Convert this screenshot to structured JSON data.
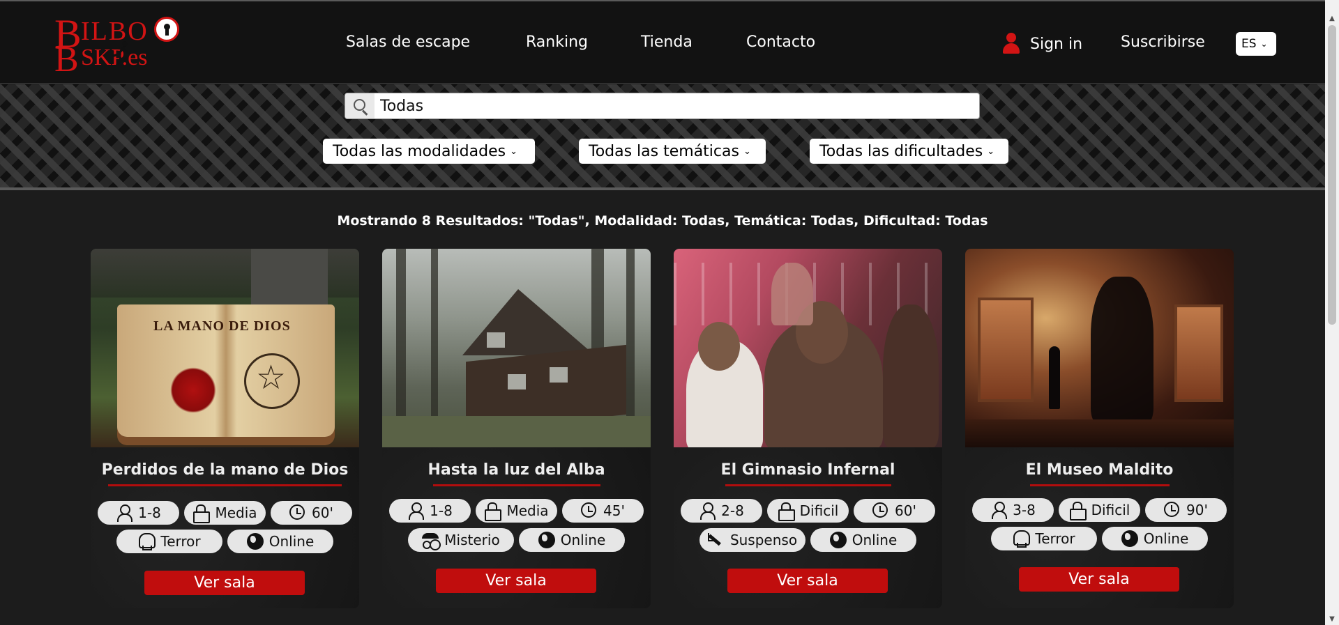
{
  "brand": {
    "logo_text_1": "B",
    "logo_text_2": "ILBO",
    "logo_text_3": "B",
    "logo_text_4": "SKP.es",
    "accent": "#d21414"
  },
  "nav": {
    "salas": "Salas de escape",
    "ranking": "Ranking",
    "tienda": "Tienda",
    "contacto": "Contacto"
  },
  "account": {
    "sign_in": "Sign in",
    "subscribe": "Suscribirse",
    "language": "ES"
  },
  "search": {
    "value": "Todas",
    "placeholder": ""
  },
  "filters": {
    "modalidad": "Todas las modalidades",
    "tematica": "Todas las temáticas",
    "dificultad": "Todas las dificultades"
  },
  "results_text": "Mostrando 8 Resultados: \"Todas\", Modalidad: Todas, Temática: Todas, Dificultad: Todas",
  "cards": [
    {
      "title": "Perdidos de la mano de Dios",
      "image_text": "LA MANO  DE DIOS",
      "players": "1-8",
      "difficulty": "Media",
      "duration": "60'",
      "theme": "Terror",
      "mode": "Online",
      "button": "Ver sala"
    },
    {
      "title": "Hasta la luz del Alba",
      "players": "1-8",
      "difficulty": "Media",
      "duration": "45'",
      "theme": "Misterio",
      "mode": "Online",
      "button": "Ver sala"
    },
    {
      "title": "El Gimnasio Infernal",
      "players": "2-8",
      "difficulty": "Dificil",
      "duration": "60'",
      "theme": "Suspenso",
      "mode": "Online",
      "button": "Ver sala"
    },
    {
      "title": "El Museo Maldito",
      "players": "3-8",
      "difficulty": "Dificil",
      "duration": "90'",
      "theme": "Terror",
      "mode": "Online",
      "button": "Ver sala"
    }
  ],
  "icons": {
    "players": "person-icon",
    "difficulty": "lock-icon",
    "duration": "clock-icon",
    "terror": "skull-icon",
    "misterio": "spy-icon",
    "suspenso": "knife-icon",
    "mode": "globe-icon"
  }
}
